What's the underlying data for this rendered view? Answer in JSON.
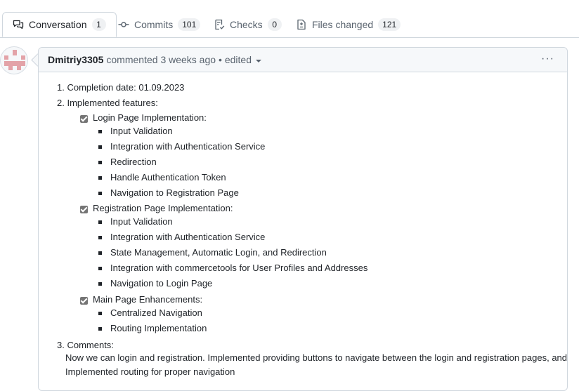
{
  "tabs": [
    {
      "label": "Conversation",
      "count": "1",
      "icon": "comment-discussion-icon"
    },
    {
      "label": "Commits",
      "count": "101",
      "icon": "git-commit-icon"
    },
    {
      "label": "Checks",
      "count": "0",
      "icon": "checklist-icon"
    },
    {
      "label": "Files changed",
      "count": "121",
      "icon": "file-diff-icon"
    }
  ],
  "comment": {
    "author": "Dmitriy3305",
    "action": "commented",
    "time": "3 weeks ago",
    "separator": "•",
    "edited": "edited",
    "menu": "···"
  },
  "body": {
    "item1": "1. Completion date: 01.09.2023",
    "item2": "2. Implemented features:",
    "login": {
      "title": "Login Page Implementation:",
      "points": [
        "Input Validation",
        "Integration with Authentication Service",
        "Redirection",
        "Handle Authentication Token",
        "Navigation to Registration Page"
      ]
    },
    "registration": {
      "title": "Registration Page Implementation:",
      "points": [
        "Input Validation",
        "Integration with Authentication Service",
        "State Management, Automatic Login, and Redirection",
        "Integration with commercetools for User Profiles and Addresses",
        "Navigation to Login Page"
      ]
    },
    "main": {
      "title": "Main Page Enhancements:",
      "points": [
        "Centralized Navigation",
        "Routing Implementation"
      ]
    },
    "item3": "3. Comments:",
    "comments_line1": "Now we can login and registration. Implemented providing buttons to navigate between the login and registration pages, and",
    "comments_line2": "Implemented routing for proper navigation"
  }
}
